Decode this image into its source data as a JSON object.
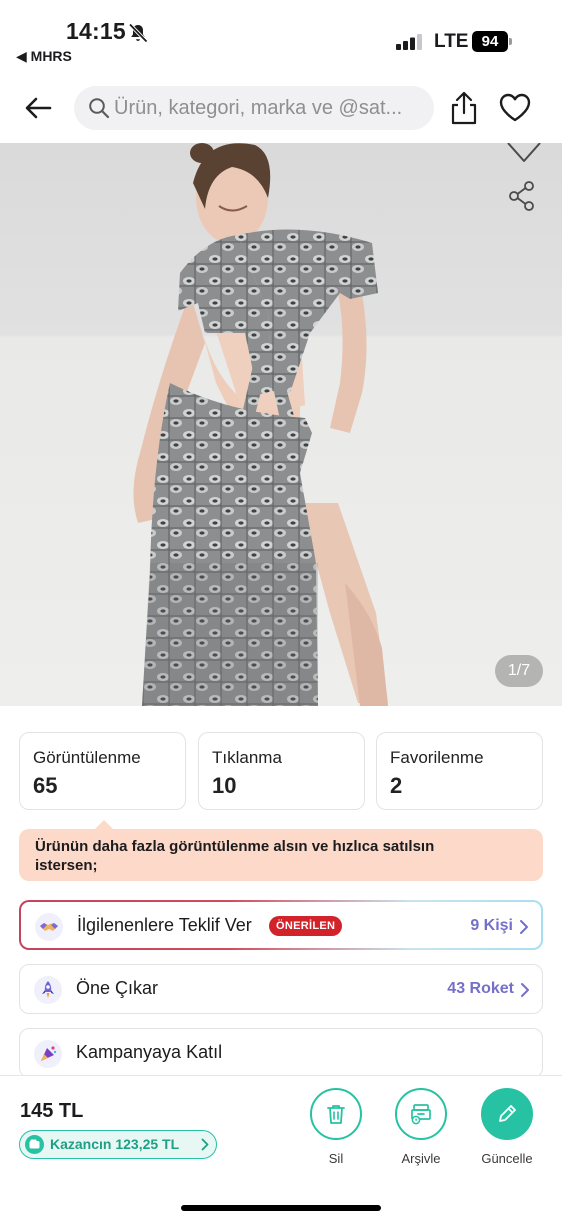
{
  "status_bar": {
    "time": "14:15",
    "back_app": "◀ MHRS",
    "network": "LTE",
    "battery": "94"
  },
  "header": {
    "search_placeholder": "Ürün, kategori, marka ve @sat..."
  },
  "gallery": {
    "counter": "1/7"
  },
  "stats": [
    {
      "label": "Görüntülenme",
      "value": "65"
    },
    {
      "label": "Tıklanma",
      "value": "10"
    },
    {
      "label": "Favorilenme",
      "value": "2"
    }
  ],
  "tip": {
    "text": "Ürünün daha fazla görüntülenme alsın ve hızlıca satılsın istersen;"
  },
  "actions": [
    {
      "title": "İlgilenenlere Teklif Ver",
      "badge": "ÖNERİLEN",
      "meta": "9 Kişi",
      "icon": "handshake-icon"
    },
    {
      "title": "Öne Çıkar",
      "meta": "43 Roket",
      "icon": "rocket-icon"
    },
    {
      "title": "Kampanyaya Katıl",
      "icon": "campaign-icon"
    }
  ],
  "bottom": {
    "price": "145 TL",
    "earnings": "Kazancın 123,25 TL",
    "buttons": [
      {
        "label": "Sil",
        "icon": "trash-icon"
      },
      {
        "label": "Arşivle",
        "icon": "archive-icon"
      },
      {
        "label": "Güncelle",
        "icon": "pencil-icon"
      }
    ]
  },
  "colors": {
    "accent": "#27c2a3",
    "badge": "#d2232a",
    "meta": "#7470c9",
    "tip_bg": "#fcd9c9"
  }
}
